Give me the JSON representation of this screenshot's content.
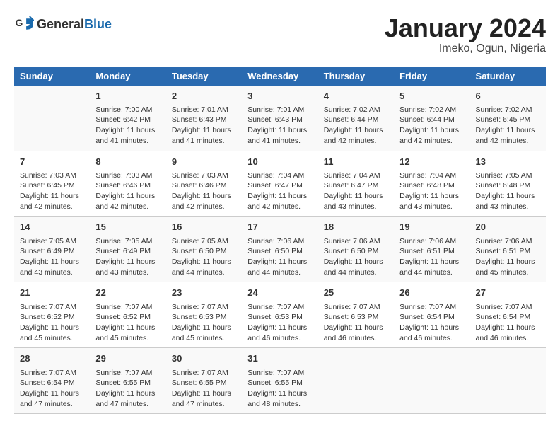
{
  "header": {
    "logo_general": "General",
    "logo_blue": "Blue",
    "title": "January 2024",
    "subtitle": "Imeko, Ogun, Nigeria"
  },
  "columns": [
    "Sunday",
    "Monday",
    "Tuesday",
    "Wednesday",
    "Thursday",
    "Friday",
    "Saturday"
  ],
  "weeks": [
    [
      {
        "day": "",
        "sunrise": "",
        "sunset": "",
        "daylight": ""
      },
      {
        "day": "1",
        "sunrise": "Sunrise: 7:00 AM",
        "sunset": "Sunset: 6:42 PM",
        "daylight": "Daylight: 11 hours and 41 minutes."
      },
      {
        "day": "2",
        "sunrise": "Sunrise: 7:01 AM",
        "sunset": "Sunset: 6:43 PM",
        "daylight": "Daylight: 11 hours and 41 minutes."
      },
      {
        "day": "3",
        "sunrise": "Sunrise: 7:01 AM",
        "sunset": "Sunset: 6:43 PM",
        "daylight": "Daylight: 11 hours and 41 minutes."
      },
      {
        "day": "4",
        "sunrise": "Sunrise: 7:02 AM",
        "sunset": "Sunset: 6:44 PM",
        "daylight": "Daylight: 11 hours and 42 minutes."
      },
      {
        "day": "5",
        "sunrise": "Sunrise: 7:02 AM",
        "sunset": "Sunset: 6:44 PM",
        "daylight": "Daylight: 11 hours and 42 minutes."
      },
      {
        "day": "6",
        "sunrise": "Sunrise: 7:02 AM",
        "sunset": "Sunset: 6:45 PM",
        "daylight": "Daylight: 11 hours and 42 minutes."
      }
    ],
    [
      {
        "day": "7",
        "sunrise": "Sunrise: 7:03 AM",
        "sunset": "Sunset: 6:45 PM",
        "daylight": "Daylight: 11 hours and 42 minutes."
      },
      {
        "day": "8",
        "sunrise": "Sunrise: 7:03 AM",
        "sunset": "Sunset: 6:46 PM",
        "daylight": "Daylight: 11 hours and 42 minutes."
      },
      {
        "day": "9",
        "sunrise": "Sunrise: 7:03 AM",
        "sunset": "Sunset: 6:46 PM",
        "daylight": "Daylight: 11 hours and 42 minutes."
      },
      {
        "day": "10",
        "sunrise": "Sunrise: 7:04 AM",
        "sunset": "Sunset: 6:47 PM",
        "daylight": "Daylight: 11 hours and 42 minutes."
      },
      {
        "day": "11",
        "sunrise": "Sunrise: 7:04 AM",
        "sunset": "Sunset: 6:47 PM",
        "daylight": "Daylight: 11 hours and 43 minutes."
      },
      {
        "day": "12",
        "sunrise": "Sunrise: 7:04 AM",
        "sunset": "Sunset: 6:48 PM",
        "daylight": "Daylight: 11 hours and 43 minutes."
      },
      {
        "day": "13",
        "sunrise": "Sunrise: 7:05 AM",
        "sunset": "Sunset: 6:48 PM",
        "daylight": "Daylight: 11 hours and 43 minutes."
      }
    ],
    [
      {
        "day": "14",
        "sunrise": "Sunrise: 7:05 AM",
        "sunset": "Sunset: 6:49 PM",
        "daylight": "Daylight: 11 hours and 43 minutes."
      },
      {
        "day": "15",
        "sunrise": "Sunrise: 7:05 AM",
        "sunset": "Sunset: 6:49 PM",
        "daylight": "Daylight: 11 hours and 43 minutes."
      },
      {
        "day": "16",
        "sunrise": "Sunrise: 7:05 AM",
        "sunset": "Sunset: 6:50 PM",
        "daylight": "Daylight: 11 hours and 44 minutes."
      },
      {
        "day": "17",
        "sunrise": "Sunrise: 7:06 AM",
        "sunset": "Sunset: 6:50 PM",
        "daylight": "Daylight: 11 hours and 44 minutes."
      },
      {
        "day": "18",
        "sunrise": "Sunrise: 7:06 AM",
        "sunset": "Sunset: 6:50 PM",
        "daylight": "Daylight: 11 hours and 44 minutes."
      },
      {
        "day": "19",
        "sunrise": "Sunrise: 7:06 AM",
        "sunset": "Sunset: 6:51 PM",
        "daylight": "Daylight: 11 hours and 44 minutes."
      },
      {
        "day": "20",
        "sunrise": "Sunrise: 7:06 AM",
        "sunset": "Sunset: 6:51 PM",
        "daylight": "Daylight: 11 hours and 45 minutes."
      }
    ],
    [
      {
        "day": "21",
        "sunrise": "Sunrise: 7:07 AM",
        "sunset": "Sunset: 6:52 PM",
        "daylight": "Daylight: 11 hours and 45 minutes."
      },
      {
        "day": "22",
        "sunrise": "Sunrise: 7:07 AM",
        "sunset": "Sunset: 6:52 PM",
        "daylight": "Daylight: 11 hours and 45 minutes."
      },
      {
        "day": "23",
        "sunrise": "Sunrise: 7:07 AM",
        "sunset": "Sunset: 6:53 PM",
        "daylight": "Daylight: 11 hours and 45 minutes."
      },
      {
        "day": "24",
        "sunrise": "Sunrise: 7:07 AM",
        "sunset": "Sunset: 6:53 PM",
        "daylight": "Daylight: 11 hours and 46 minutes."
      },
      {
        "day": "25",
        "sunrise": "Sunrise: 7:07 AM",
        "sunset": "Sunset: 6:53 PM",
        "daylight": "Daylight: 11 hours and 46 minutes."
      },
      {
        "day": "26",
        "sunrise": "Sunrise: 7:07 AM",
        "sunset": "Sunset: 6:54 PM",
        "daylight": "Daylight: 11 hours and 46 minutes."
      },
      {
        "day": "27",
        "sunrise": "Sunrise: 7:07 AM",
        "sunset": "Sunset: 6:54 PM",
        "daylight": "Daylight: 11 hours and 46 minutes."
      }
    ],
    [
      {
        "day": "28",
        "sunrise": "Sunrise: 7:07 AM",
        "sunset": "Sunset: 6:54 PM",
        "daylight": "Daylight: 11 hours and 47 minutes."
      },
      {
        "day": "29",
        "sunrise": "Sunrise: 7:07 AM",
        "sunset": "Sunset: 6:55 PM",
        "daylight": "Daylight: 11 hours and 47 minutes."
      },
      {
        "day": "30",
        "sunrise": "Sunrise: 7:07 AM",
        "sunset": "Sunset: 6:55 PM",
        "daylight": "Daylight: 11 hours and 47 minutes."
      },
      {
        "day": "31",
        "sunrise": "Sunrise: 7:07 AM",
        "sunset": "Sunset: 6:55 PM",
        "daylight": "Daylight: 11 hours and 48 minutes."
      },
      {
        "day": "",
        "sunrise": "",
        "sunset": "",
        "daylight": ""
      },
      {
        "day": "",
        "sunrise": "",
        "sunset": "",
        "daylight": ""
      },
      {
        "day": "",
        "sunrise": "",
        "sunset": "",
        "daylight": ""
      }
    ]
  ]
}
